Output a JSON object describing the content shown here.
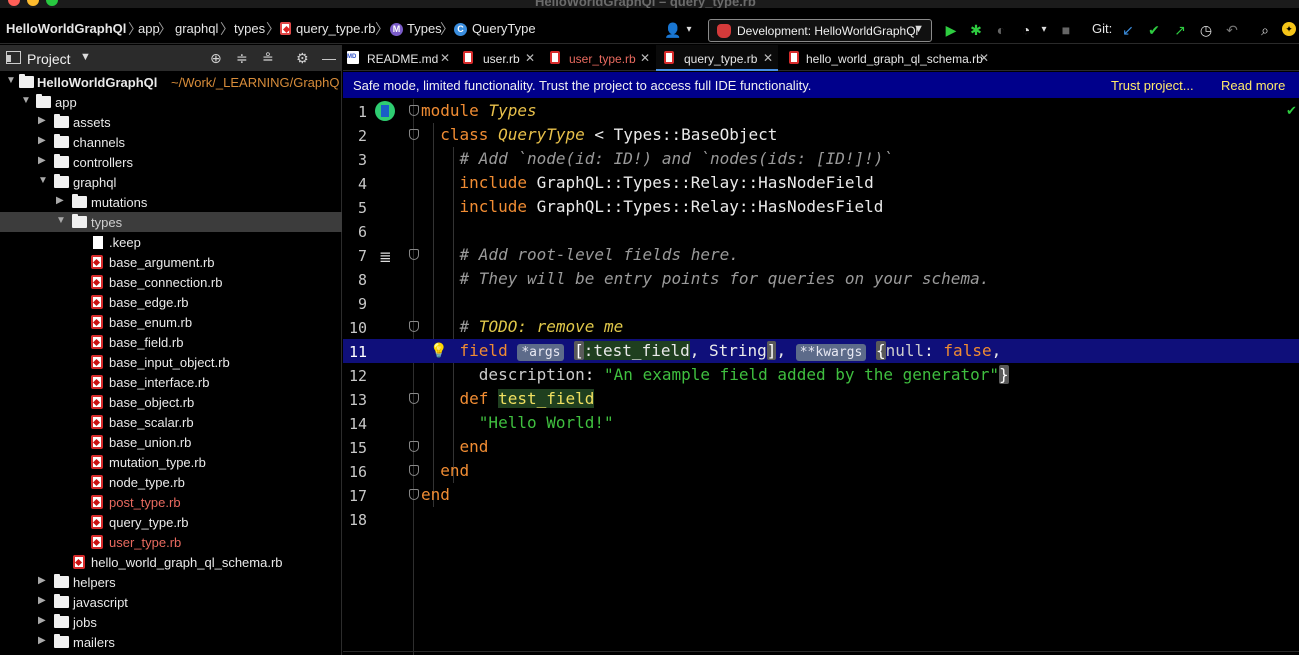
{
  "window": {
    "title": "HelloWorldGraphQl – query_type.rb"
  },
  "breadcrumb": {
    "items": [
      "HelloWorldGraphQl",
      "app",
      "graphql",
      "types",
      "query_type.rb",
      "Types",
      "QueryType"
    ]
  },
  "toolbar": {
    "run_config": "Development: HelloWorldGraphQl",
    "git_label": "Git:"
  },
  "sidebar": {
    "title": "Project",
    "root_name": "HelloWorldGraphQl",
    "root_path": "~/Work/_LEARNING/GraphQ",
    "items": [
      {
        "label": "app"
      },
      {
        "label": "assets"
      },
      {
        "label": "channels"
      },
      {
        "label": "controllers"
      },
      {
        "label": "graphql"
      },
      {
        "label": "mutations"
      },
      {
        "label": "types"
      },
      {
        "label": ".keep"
      },
      {
        "label": "base_argument.rb"
      },
      {
        "label": "base_connection.rb"
      },
      {
        "label": "base_edge.rb"
      },
      {
        "label": "base_enum.rb"
      },
      {
        "label": "base_field.rb"
      },
      {
        "label": "base_input_object.rb"
      },
      {
        "label": "base_interface.rb"
      },
      {
        "label": "base_object.rb"
      },
      {
        "label": "base_scalar.rb"
      },
      {
        "label": "base_union.rb"
      },
      {
        "label": "mutation_type.rb"
      },
      {
        "label": "node_type.rb"
      },
      {
        "label": "post_type.rb"
      },
      {
        "label": "query_type.rb"
      },
      {
        "label": "user_type.rb"
      },
      {
        "label": "hello_world_graph_ql_schema.rb"
      },
      {
        "label": "helpers"
      },
      {
        "label": "javascript"
      },
      {
        "label": "jobs"
      },
      {
        "label": "mailers"
      }
    ]
  },
  "tabs": [
    {
      "label": "README.md"
    },
    {
      "label": "user.rb"
    },
    {
      "label": "user_type.rb"
    },
    {
      "label": "query_type.rb"
    },
    {
      "label": "hello_world_graph_ql_schema.rb"
    }
  ],
  "banner": {
    "message": "Safe mode, limited functionality. Trust the project to access full IDE functionality.",
    "trust_link": "Trust project...",
    "read_more": "Read more"
  },
  "editor": {
    "line_numbers": [
      "1",
      "2",
      "3",
      "4",
      "5",
      "6",
      "7",
      "8",
      "9",
      "10",
      "11",
      "12",
      "13",
      "14",
      "15",
      "16",
      "17",
      "18"
    ],
    "current_line": "11",
    "tokens": {
      "module": "module",
      "types": "Types",
      "class": "class",
      "query_type": "QueryType",
      "base_object": " < Types::BaseObject",
      "comment1": "# Add `node(id: ID!) and `nodes(ids: [ID!]!)`",
      "include": "include",
      "has_node_field": " GraphQL::Types::Relay::HasNodeField",
      "has_nodes_field": " GraphQL::Types::Relay::HasNodesField",
      "comment2": "# Add root-level fields here.",
      "comment3": "# They will be entry points for queries on your schema.",
      "todo_hash": "#",
      "todo": " TODO: remove me",
      "field": "field",
      "hint_args": "*args",
      "open_bracket": "[",
      "test_field_sym": ":test_field",
      "comma_string": ", String",
      "close_bracket": "]",
      "comma": ",",
      "hint_kwargs": "**kwargs",
      "open_brace": "{",
      "null_key": "null",
      "colon": ": ",
      "false": "false",
      "trailing_comma": ",",
      "description_key": "description",
      "desc_colon": ": ",
      "desc_string": "\"An example field added by the generator\"",
      "close_brace": "}",
      "def": "def",
      "test_field": "test_field",
      "hello_string": "\"Hello World!\"",
      "end": "end"
    }
  }
}
